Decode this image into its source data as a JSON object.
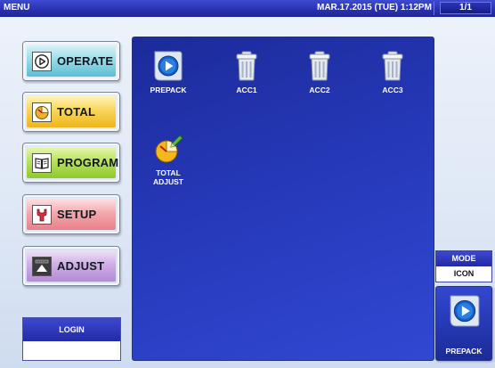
{
  "topbar": {
    "title": "MENU",
    "datetime": "MAR.17.2015 (TUE)  1:12PM",
    "page": "1/1"
  },
  "menu": {
    "operate": {
      "label": "OPERATE",
      "icon": "play-circle-icon"
    },
    "total": {
      "label": "TOTAL",
      "icon": "pie-clock-icon"
    },
    "program": {
      "label": "PROGRAM",
      "icon": "book-icon"
    },
    "setup": {
      "label": "SETUP",
      "icon": "wrench-icon"
    },
    "adjust": {
      "label": "ADJUST",
      "icon": "scale-adjust-icon"
    }
  },
  "login": {
    "label": "LOGIN",
    "value": ""
  },
  "tiles": [
    {
      "label": "PREPACK",
      "icon": "prepack-play-icon"
    },
    {
      "label": "ACC1",
      "icon": "trash-bin-icon"
    },
    {
      "label": "ACC2",
      "icon": "trash-bin-icon"
    },
    {
      "label": "ACC3",
      "icon": "trash-bin-icon"
    },
    {
      "label": "TOTAL\nADJUST",
      "icon": "total-adjust-pencil-icon"
    }
  ],
  "mode": {
    "label": "MODE",
    "value": "ICON"
  },
  "shortcut": {
    "label": "PREPACK",
    "icon": "prepack-play-icon"
  },
  "colors": {
    "bar_blue": "#2a32b4",
    "panel_blue": "#2538b8",
    "operate": "#5bbfd5",
    "total": "#eeb51c",
    "program": "#8fc92b",
    "setup": "#e98089",
    "adjust": "#b48ad6"
  }
}
